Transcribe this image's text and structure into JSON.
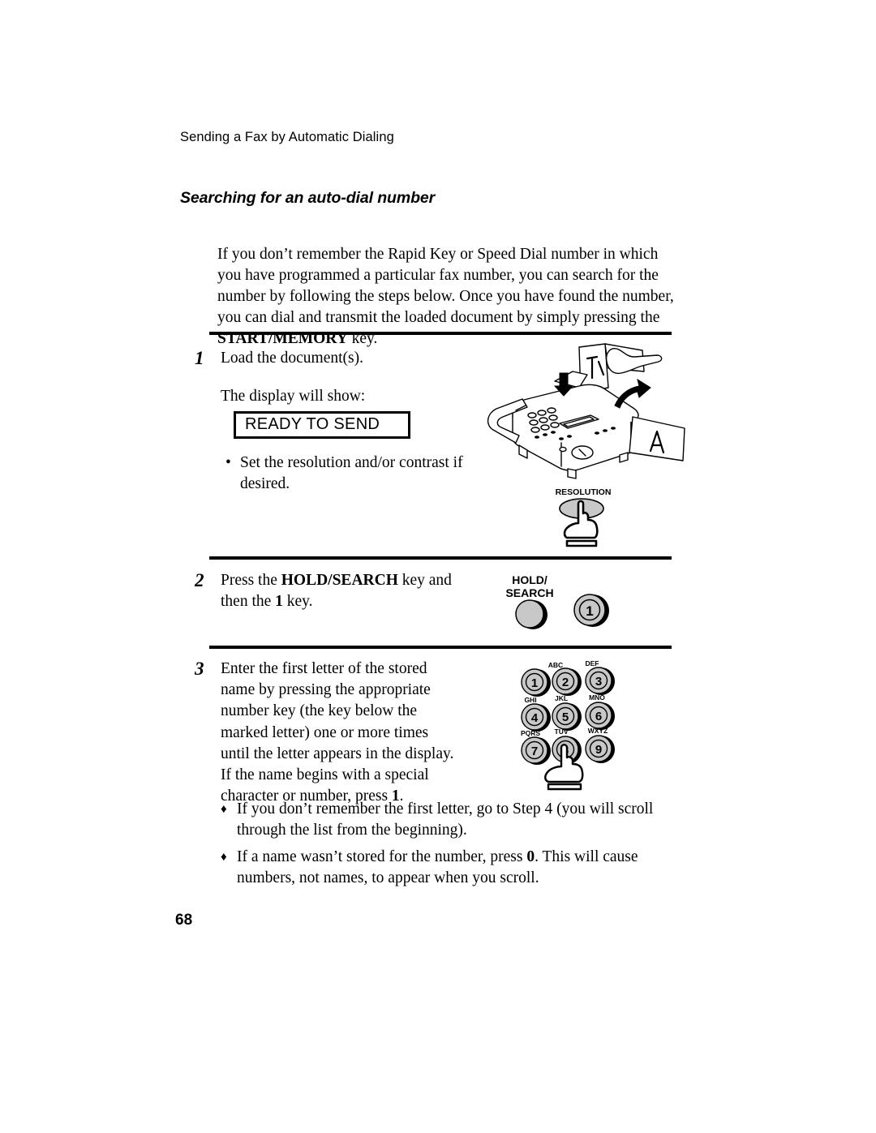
{
  "document": {
    "running_header": "Sending a Fax by Automatic Dialing",
    "section_heading": "Searching for an auto-dial number",
    "page_number": "68"
  },
  "intro": {
    "text_before_bold": "If you don’t remember the Rapid Key or Speed Dial number in which you have programmed a particular fax number, you can search for the number by following the steps below. Once you have found the number, you can dial and transmit the loaded document by simply pressing the ",
    "bold_key": "START/MEMORY",
    "text_after_bold": " key."
  },
  "steps": [
    {
      "number": "1",
      "line1": "Load the document(s).",
      "line2": "The display will show:",
      "lcd_text": "READY TO SEND",
      "bullet": "Set the resolution and/or contrast if desired."
    },
    {
      "number": "2",
      "text_before_bold": "Press the ",
      "bold_key": "HOLD/SEARCH",
      "text_middle": " key and then the ",
      "bold_key2": "1",
      "text_after": " key."
    },
    {
      "number": "3",
      "text_before_bold": "Enter the first letter of the stored name by pressing the appropriate number key (the key below the marked letter) one or more times until the letter appears in the display. If the name begins with a special character or number, press ",
      "bold_key": "1",
      "text_after_bold": "."
    }
  ],
  "bullets": [
    {
      "text": "If you don’t remember the first letter, go to Step 4 (you will scroll through the list from the beginning)."
    },
    {
      "text_before_bold": "If a name wasn’t stored for the number, press ",
      "bold_key": "0",
      "text_after_bold": ". This will cause numbers, not names, to appear when you scroll."
    }
  ],
  "figures": {
    "fax_machine": {
      "name": "fax-machine-loading-document-illustration"
    },
    "resolution_button": {
      "label": "RESOLUTION"
    },
    "hold_search": {
      "label_line1": "HOLD/",
      "label_line2": "SEARCH",
      "key_label": "1"
    },
    "keypad": {
      "keys": [
        {
          "digit": "1",
          "letters": ""
        },
        {
          "digit": "2",
          "letters": "ABC"
        },
        {
          "digit": "3",
          "letters": "DEF"
        },
        {
          "digit": "4",
          "letters": "GHI"
        },
        {
          "digit": "5",
          "letters": "JKL"
        },
        {
          "digit": "6",
          "letters": "MNO"
        },
        {
          "digit": "7",
          "letters": "PQRS"
        },
        {
          "digit": "8",
          "letters": "TUV"
        },
        {
          "digit": "9",
          "letters": "WXYZ"
        }
      ],
      "pressed_key": "8"
    }
  },
  "colors": {
    "ink": "#000000",
    "paper": "#ffffff",
    "button_fill": "#c8c8c8",
    "button_fill_light": "#d9d9d9"
  }
}
